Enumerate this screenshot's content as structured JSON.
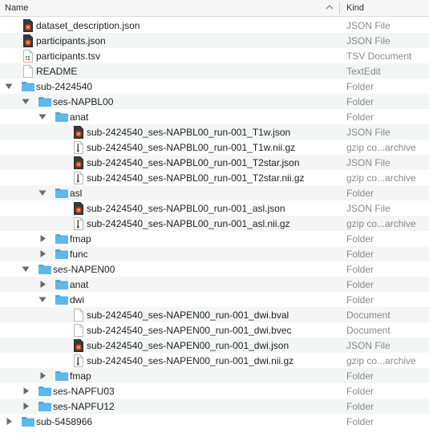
{
  "header": {
    "name_label": "Name",
    "kind_label": "Kind"
  },
  "rows": [
    {
      "name": "dataset_description.json",
      "kind": "JSON File",
      "depth": 0,
      "icon": "json-file-icon"
    },
    {
      "name": "participants.json",
      "kind": "JSON File",
      "depth": 0,
      "icon": "json-file-icon"
    },
    {
      "name": "participants.tsv",
      "kind": "TSV Document",
      "depth": 0,
      "icon": "tsv-file-icon"
    },
    {
      "name": "README",
      "kind": "TextEdit",
      "depth": 0,
      "icon": "text-file-icon"
    },
    {
      "name": "sub-2424540",
      "kind": "Folder",
      "depth": 0,
      "icon": "folder-icon",
      "expanded": true
    },
    {
      "name": "ses-NAPBL00",
      "kind": "Folder",
      "depth": 1,
      "icon": "folder-icon",
      "expanded": true
    },
    {
      "name": "anat",
      "kind": "Folder",
      "depth": 2,
      "icon": "folder-icon",
      "expanded": true
    },
    {
      "name": "sub-2424540_ses-NAPBL00_run-001_T1w.json",
      "kind": "JSON File",
      "depth": 3,
      "icon": "json-file-icon"
    },
    {
      "name": "sub-2424540_ses-NAPBL00_run-001_T1w.nii.gz",
      "kind": "gzip co...archive",
      "depth": 3,
      "icon": "archive-file-icon"
    },
    {
      "name": "sub-2424540_ses-NAPBL00_run-001_T2star.json",
      "kind": "JSON File",
      "depth": 3,
      "icon": "json-file-icon"
    },
    {
      "name": "sub-2424540_ses-NAPBL00_run-001_T2star.nii.gz",
      "kind": "gzip co...archive",
      "depth": 3,
      "icon": "archive-file-icon"
    },
    {
      "name": "asl",
      "kind": "Folder",
      "depth": 2,
      "icon": "folder-icon",
      "expanded": true
    },
    {
      "name": "sub-2424540_ses-NAPBL00_run-001_asl.json",
      "kind": "JSON File",
      "depth": 3,
      "icon": "json-file-icon"
    },
    {
      "name": "sub-2424540_ses-NAPBL00_run-001_asl.nii.gz",
      "kind": "gzip co...archive",
      "depth": 3,
      "icon": "archive-file-icon"
    },
    {
      "name": "fmap",
      "kind": "Folder",
      "depth": 2,
      "icon": "folder-icon",
      "expanded": false
    },
    {
      "name": "func",
      "kind": "Folder",
      "depth": 2,
      "icon": "folder-icon",
      "expanded": false
    },
    {
      "name": "ses-NAPEN00",
      "kind": "Folder",
      "depth": 1,
      "icon": "folder-icon",
      "expanded": true
    },
    {
      "name": "anat",
      "kind": "Folder",
      "depth": 2,
      "icon": "folder-icon",
      "expanded": false
    },
    {
      "name": "dwi",
      "kind": "Folder",
      "depth": 2,
      "icon": "folder-icon",
      "expanded": true
    },
    {
      "name": "sub-2424540_ses-NAPEN00_run-001_dwi.bval",
      "kind": "Document",
      "depth": 3,
      "icon": "document-file-icon"
    },
    {
      "name": "sub-2424540_ses-NAPEN00_run-001_dwi.bvec",
      "kind": "Document",
      "depth": 3,
      "icon": "document-file-icon"
    },
    {
      "name": "sub-2424540_ses-NAPEN00_run-001_dwi.json",
      "kind": "JSON File",
      "depth": 3,
      "icon": "json-file-icon"
    },
    {
      "name": "sub-2424540_ses-NAPEN00_run-001_dwi.nii.gz",
      "kind": "gzip co...archive",
      "depth": 3,
      "icon": "archive-file-icon"
    },
    {
      "name": "fmap",
      "kind": "Folder",
      "depth": 2,
      "icon": "folder-icon",
      "expanded": false
    },
    {
      "name": "ses-NAPFU03",
      "kind": "Folder",
      "depth": 1,
      "icon": "folder-icon",
      "expanded": false
    },
    {
      "name": "ses-NAPFU12",
      "kind": "Folder",
      "depth": 1,
      "icon": "folder-icon",
      "expanded": false
    },
    {
      "name": "sub-5458966",
      "kind": "Folder",
      "depth": 0,
      "icon": "folder-icon",
      "expanded": false
    }
  ],
  "colors": {
    "folder": "#5fb8ea",
    "folder_tab": "#4aa6dc",
    "json_icon": "#c03a2b",
    "kind_text": "#8a8a8a",
    "alt_row": "#f4f5f5"
  }
}
